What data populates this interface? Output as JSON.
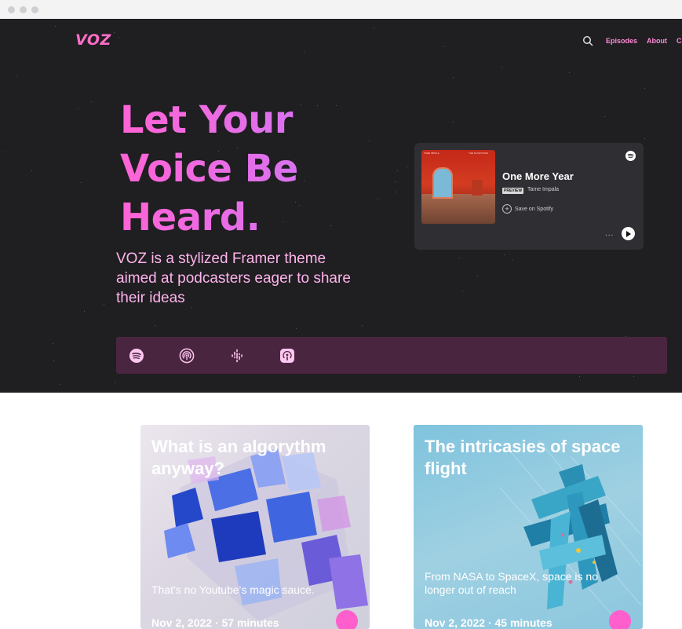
{
  "browser": {
    "controls": [
      "close-dot",
      "minimize-dot",
      "maximize-dot"
    ]
  },
  "header": {
    "logo": "VOZ",
    "nav": [
      {
        "label": "Episodes"
      },
      {
        "label": "About"
      },
      {
        "label": "Co"
      }
    ]
  },
  "hero": {
    "headline_lines": [
      "Let Your",
      "Voice Be",
      "Heard."
    ],
    "subtitle": "VOZ is a stylized Framer theme aimed at podcasters eager to share their ideas"
  },
  "player": {
    "track": "One More Year",
    "badge": "PREVIEW",
    "artist": "Tame Impala",
    "save_label": "Save on Spotify",
    "more": "...",
    "album_text_left": "TAME IMPALA",
    "album_text_right": "THE SLOW RUSH"
  },
  "platforms": [
    {
      "icon": "spotify-icon"
    },
    {
      "icon": "podcast-broadcast-icon"
    },
    {
      "icon": "google-podcasts-icon"
    },
    {
      "icon": "apple-podcasts-icon"
    }
  ],
  "episodes": [
    {
      "title": "What is an algorythm anyway?",
      "description": "That's no Youtube's magic sauce.",
      "meta": "Nov 2, 2022 · 57 minutes"
    },
    {
      "title": "The intricasies of space flight",
      "description": "From NASA to SpaceX, space is no longer out of reach",
      "meta": "Nov 2, 2022 · 45 minutes"
    }
  ],
  "colors": {
    "hero_bg": "#1f1e21",
    "accent_pink": "#ff63d5",
    "accent_purple": "#c27cff",
    "platform_bar": "#4a2540",
    "player_bg": "#2f2f33"
  }
}
